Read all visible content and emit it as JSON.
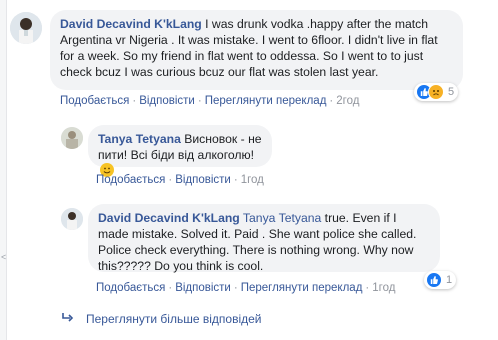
{
  "comments": [
    {
      "author": "David Decavind K'kLang",
      "text": " I was drunk vodka .happy after the match Argentina vr Nigeria . It was mistake. I went to 6floor. I didn't live in flat for a week. So my friend in flat went to oddessa. So I went to to just check bcuz I was curious bcuz our flat was stolen last year.",
      "actions": {
        "like": "Подобається",
        "reply": "Відповісти",
        "translate": "Переглянути переклад",
        "time": "2год"
      },
      "reaction_count": "5"
    },
    {
      "author": "Tanya Tetyana",
      "text": " Висновок - не пити! Всі біди від алкоголю!",
      "actions": {
        "like": "Подобається",
        "reply": "Відповісти",
        "time": "1год"
      }
    },
    {
      "author": "David Decavind K'kLang",
      "tag": "Tanya Tetyana",
      "text": " true. Even if I made mistake. Solved it. Paid . She want police she called. Police check everything. There is nothing wrong. Why now this????? Do you think is cool.",
      "actions": {
        "like": "Подобається",
        "reply": "Відповісти",
        "translate": "Переглянути переклад",
        "time": "1год"
      },
      "reaction_count": "1"
    }
  ],
  "more_replies": "Переглянути більше відповідей",
  "separator": "·",
  "colors": {
    "link": "#385898",
    "bubble": "#f2f3f5",
    "meta": "#90949c",
    "like": "#1877f2"
  },
  "icons": {
    "like": "like-reaction-icon",
    "sad": "sad-reaction-icon",
    "smile": "smile-emoji-icon",
    "reply_arrow": "reply-arrow-icon"
  }
}
